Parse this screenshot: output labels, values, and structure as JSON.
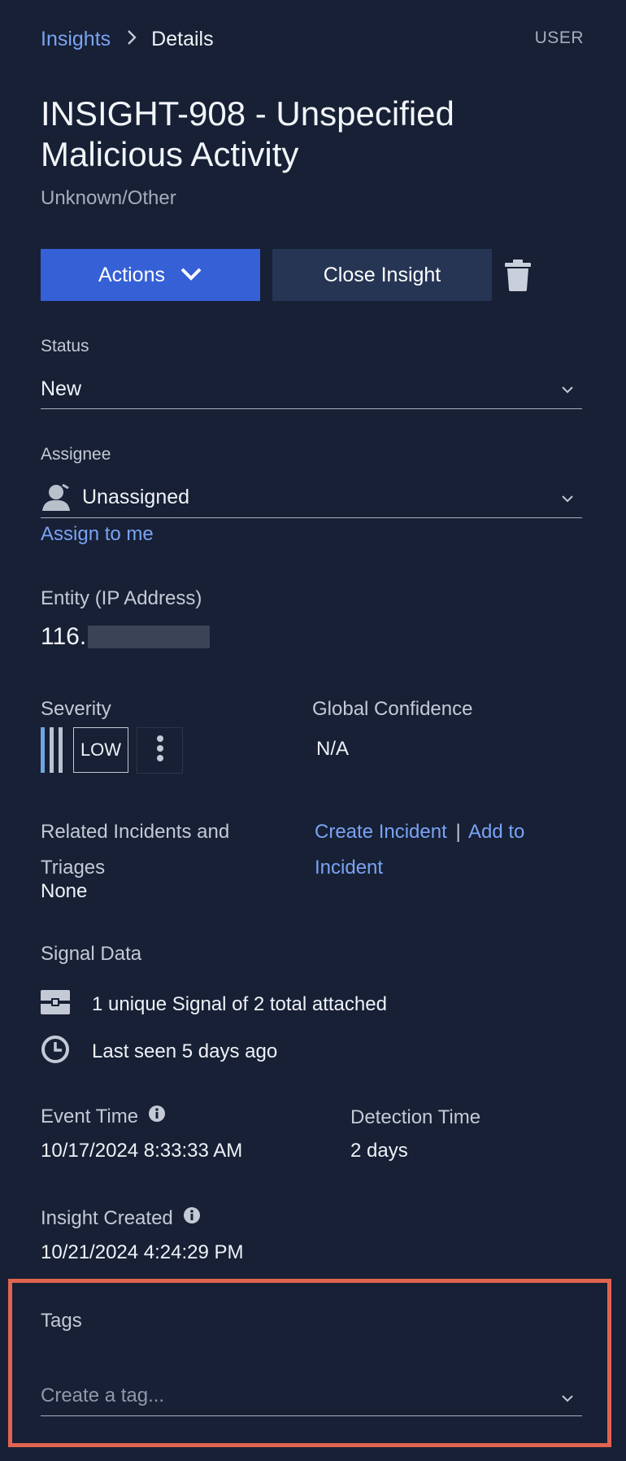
{
  "breadcrumb": {
    "parent": "Insights",
    "separator": "›",
    "current": "Details"
  },
  "user_label": "USER",
  "insight": {
    "title_line1": "INSIGHT-908 - Unspecified",
    "title_line2": "Malicious Activity",
    "category": "Unknown/Other"
  },
  "actions": {
    "actions_label": "Actions",
    "close_label": "Close Insight"
  },
  "status": {
    "label": "Status",
    "value": "New"
  },
  "assignee": {
    "label": "Assignee",
    "value": "Unassigned",
    "assign_link": "Assign to me"
  },
  "entity": {
    "label": "Entity (IP Address)",
    "value_prefix": "116."
  },
  "severity": {
    "label": "Severity",
    "level": "LOW"
  },
  "global_confidence": {
    "label": "Global Confidence",
    "value": "N/A"
  },
  "related": {
    "label_line1": "Related Incidents and",
    "label_line2": "Triages",
    "value": "None",
    "create_link": "Create Incident",
    "separator": "|",
    "add_link_line1": "Add to",
    "add_link_line2": "Incident"
  },
  "signal_data": {
    "label": "Signal Data",
    "signals_text": "1 unique Signal of 2 total attached",
    "last_seen_text": "Last seen 5 days ago"
  },
  "event_time": {
    "label": "Event Time",
    "value": "10/17/2024 8:33:33 AM"
  },
  "detection_time": {
    "label": "Detection Time",
    "value": "2 days"
  },
  "insight_created": {
    "label": "Insight Created",
    "value": "10/21/2024 4:24:29 PM"
  },
  "tags": {
    "label": "Tags",
    "placeholder": "Create a tag..."
  },
  "colors": {
    "background": "#172034",
    "primary_button": "#3560d6",
    "secondary_button": "#263554",
    "link": "#7aa3f5",
    "highlight": "#e0644f",
    "severity_bar": "#6fa6dc"
  }
}
